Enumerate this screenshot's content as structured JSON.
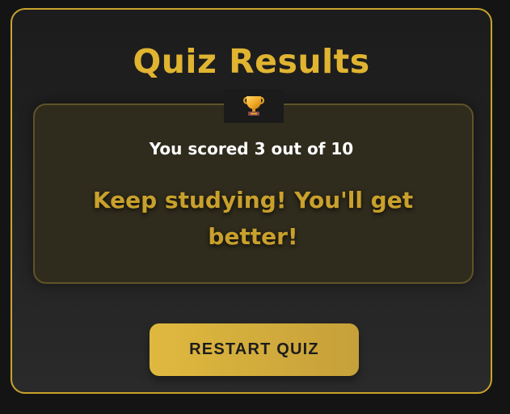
{
  "quiz_results": {
    "title": "Quiz Results",
    "trophy_icon": "trophy-icon",
    "score_text": "You scored 3 out of 10",
    "message": "Keep studying! You'll get better!",
    "restart_button_label": "RESTART QUIZ"
  },
  "colors": {
    "accent": "#e0b431",
    "card_border": "#c9a32c",
    "panel_background": "#2f2b1d",
    "button_background": "#d5b13b"
  }
}
